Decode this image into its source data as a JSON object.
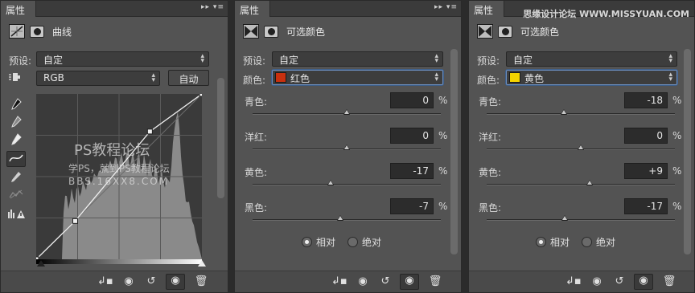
{
  "panel_tab": "属性",
  "watermark": "思缘设计论坛 WWW.MISSYUAN.COM",
  "curves": {
    "title": "曲线",
    "preset_label": "预设:",
    "preset_value": "自定",
    "channel_value": "RGB",
    "auto_button": "自动",
    "graph_watermark_1": "PS教程论坛",
    "graph_watermark_2": "学PS，就到PS教程论坛",
    "graph_watermark_3": "BBS.16XX8.COM",
    "curve_points": [
      [
        0,
        0
      ],
      [
        60,
        59
      ],
      [
        175,
        197
      ],
      [
        255,
        255
      ]
    ]
  },
  "selective_red": {
    "title": "可选颜色",
    "preset_label": "预设:",
    "preset_value": "自定",
    "color_label": "颜色:",
    "color_value": "红色",
    "swatch_color": "#c8300f",
    "sliders": [
      {
        "label": "青色:",
        "value": "0",
        "level": 0
      },
      {
        "label": "洋红:",
        "value": "0",
        "level": 0
      },
      {
        "label": "黄色:",
        "value": "-17",
        "level": -17
      },
      {
        "label": "黑色:",
        "value": "-7",
        "level": -7
      }
    ],
    "pct": "%",
    "radio_relative": "相对",
    "radio_absolute": "绝对",
    "selected_mode": "relative"
  },
  "selective_yellow": {
    "title": "可选颜色",
    "preset_label": "预设:",
    "preset_value": "自定",
    "color_label": "颜色:",
    "color_value": "黄色",
    "swatch_color": "#f5d400",
    "sliders": [
      {
        "label": "青色:",
        "value": "-18",
        "level": -18
      },
      {
        "label": "洋红:",
        "value": "0",
        "level": 0
      },
      {
        "label": "黄色:",
        "value": "+9",
        "level": 9
      },
      {
        "label": "黑色:",
        "value": "-17",
        "level": -17
      }
    ],
    "pct": "%",
    "radio_relative": "相对",
    "radio_absolute": "绝对",
    "selected_mode": "relative"
  }
}
